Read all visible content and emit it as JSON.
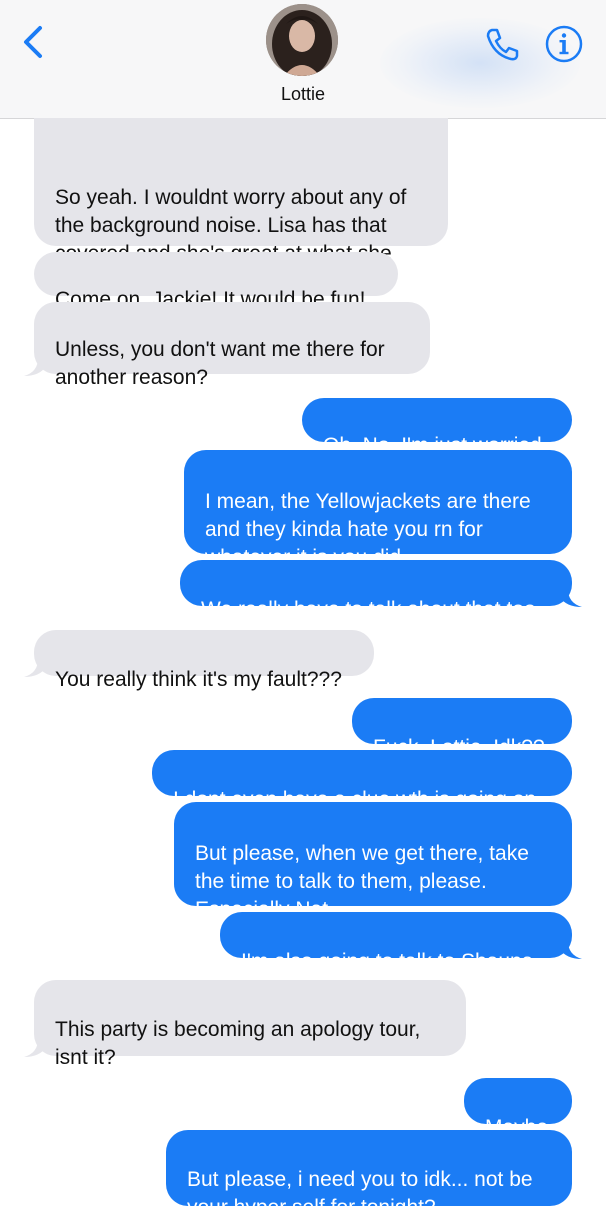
{
  "header": {
    "contact_name": "Lottie"
  },
  "icons": {
    "back": "chevron-left-icon",
    "call": "phone-icon",
    "info": "info-icon",
    "accent_color": "#1b7cf5"
  },
  "messages": [
    {
      "direction": "incoming",
      "text": "So yeah. I wouldnt worry about any of\nthe background noise. Lisa has that\ncovered and she's great at what she\ndoes."
    },
    {
      "direction": "incoming",
      "text": "Come on, Jackie! It would be fun!"
    },
    {
      "direction": "incoming",
      "text": "Unless, you don't want me there for\nanother reason?"
    },
    {
      "direction": "outgoing",
      "text": "Oh. No. I'm just worried"
    },
    {
      "direction": "outgoing",
      "text": "I mean, the Yellowjackets are there\nand they kinda hate you rn for\nwhatever it is you did"
    },
    {
      "direction": "outgoing",
      "text": "We really have to talk about that too"
    },
    {
      "direction": "incoming",
      "text": "You really think it's my fault???"
    },
    {
      "direction": "outgoing",
      "text": "Fuck, Lottie. Idk??"
    },
    {
      "direction": "outgoing",
      "text": "I dont even have a clue wth is going on"
    },
    {
      "direction": "outgoing",
      "text": "But please, when we get there, take\nthe time to talk to them, please.\nEspecially Nat"
    },
    {
      "direction": "outgoing",
      "text": "I'm also going to talk to Shauna"
    },
    {
      "direction": "incoming",
      "text": "This party is becoming an apology tour,\nisnt it?"
    },
    {
      "direction": "outgoing",
      "text": "Maybe"
    },
    {
      "direction": "outgoing",
      "text": "But please, i need you to idk... not be\nyour hyper self for tonight?"
    }
  ]
}
